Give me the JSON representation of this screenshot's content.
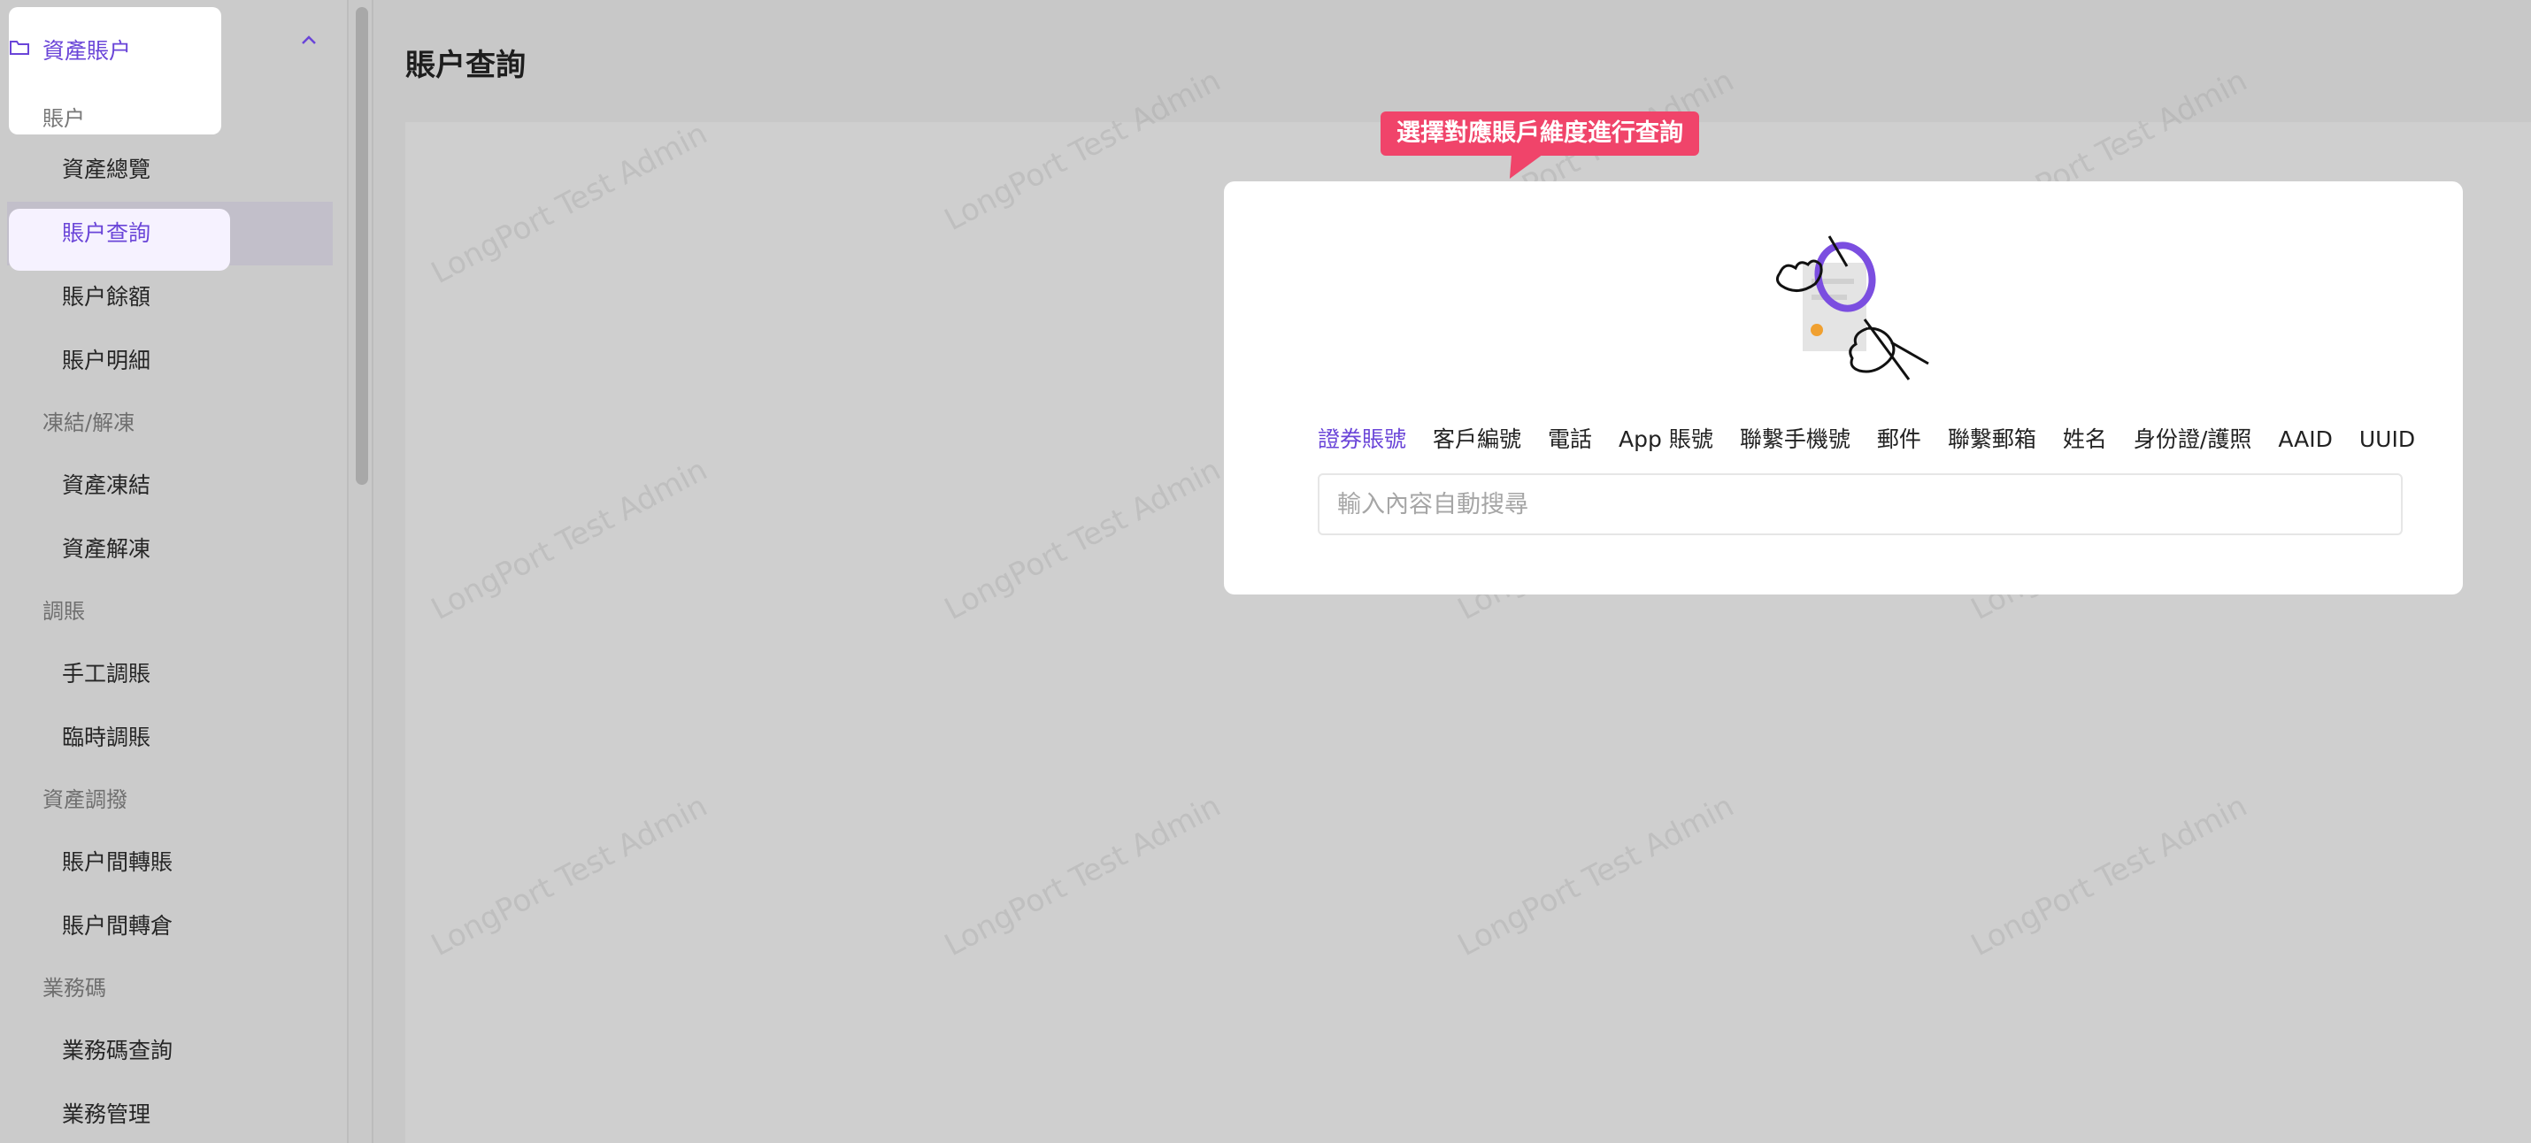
{
  "sidebar": {
    "group_title": "資產賬户",
    "header_sublabel": "賬户",
    "items": [
      {
        "label": "資產總覽"
      },
      {
        "label": "賬户查詢"
      },
      {
        "label": "賬户餘額"
      },
      {
        "label": "賬户明細"
      }
    ],
    "section_freeze": "凍結/解凍",
    "freeze_items": [
      {
        "label": "資產凍結"
      },
      {
        "label": "資產解凍"
      }
    ],
    "section_adjust": "調賬",
    "adjust_items": [
      {
        "label": "手工調賬"
      },
      {
        "label": "臨時調賬"
      }
    ],
    "section_transfer": "資產調撥",
    "transfer_items": [
      {
        "label": "賬户間轉賬"
      },
      {
        "label": "賬户間轉倉"
      }
    ],
    "section_bizcode": "業務碼",
    "bizcode_items": [
      {
        "label": "業務碼查詢"
      },
      {
        "label": "業務管理"
      }
    ]
  },
  "main": {
    "page_title": "賬户查詢",
    "tooltip": "選擇對應賬戶維度進行查詢",
    "watermark": "LongPort Test Admin",
    "tabs": [
      {
        "label": "證券賬號"
      },
      {
        "label": "客戶編號"
      },
      {
        "label": "電話"
      },
      {
        "label": "App 賬號"
      },
      {
        "label": "聯繫手機號"
      },
      {
        "label": "郵件"
      },
      {
        "label": "聯繫郵箱"
      },
      {
        "label": "姓名"
      },
      {
        "label": "身份證/護照"
      },
      {
        "label": "AAID"
      },
      {
        "label": "UUID"
      }
    ],
    "search_placeholder": "輸入內容自動搜尋"
  },
  "colors": {
    "accent": "#6a45d8",
    "tooltip_bg": "#f0446a",
    "overlay": "#c8c8c8"
  }
}
